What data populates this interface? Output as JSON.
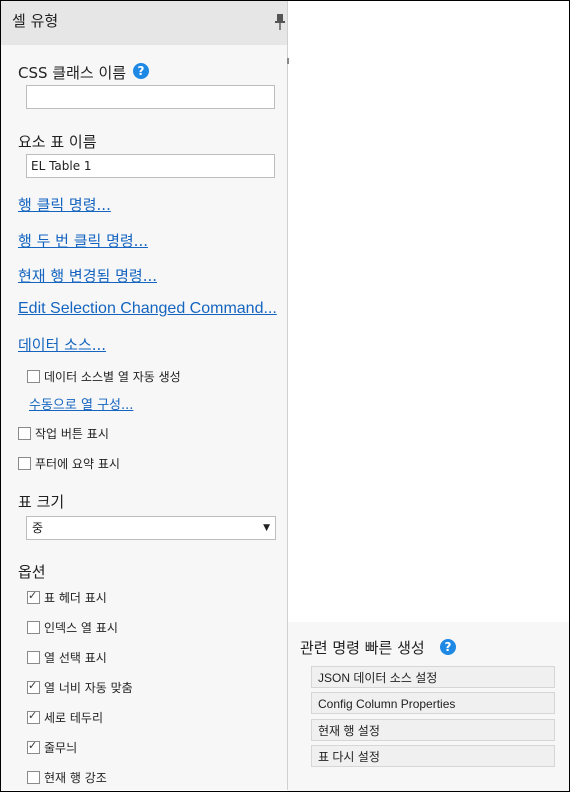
{
  "panel": {
    "title": "셀 유형",
    "css_class_label": "CSS 클래스 이름",
    "css_class_value": "",
    "element_label": "요소 표 이름",
    "element_value": "EL Table 1",
    "links": [
      "행 클릭 명령...",
      "행 두 번 클릭 명령...",
      "현재 행 변경됨 명령...",
      "Edit Selection Changed Command...",
      "데이터 소스..."
    ],
    "auto_generate_label": "데이터 소스별 열 자동 생성",
    "configure_columns_link": "수동으로 열 구성...",
    "show_action_buttons": "작업 버튼 표시",
    "show_footer_summary": "푸터에 요약 표시",
    "table_size_label": "표 크기",
    "table_size_value": "중",
    "options_label": "옵션",
    "options": [
      {
        "label": "표 헤더 표시",
        "checked": true
      },
      {
        "label": "인덱스 열 표시",
        "checked": false
      },
      {
        "label": "열 선택 표시",
        "checked": false
      },
      {
        "label": "열 너비 자동 맞춤",
        "checked": true
      },
      {
        "label": "세로 테두리",
        "checked": true
      },
      {
        "label": "줄무늬",
        "checked": true
      },
      {
        "label": "현재 행 강조",
        "checked": false
      }
    ]
  },
  "quick": {
    "title": "관련 명령 빠른 생성",
    "buttons": [
      "JSON 데이터 소스 설정",
      "Config Column Properties",
      "현재 행 설정",
      "표 다시 설정"
    ]
  },
  "colors": {
    "accent": "#1e88e5",
    "link": "#1565c0",
    "panel_bg": "#f7f7f7",
    "header_bg": "#e6e6e6"
  }
}
